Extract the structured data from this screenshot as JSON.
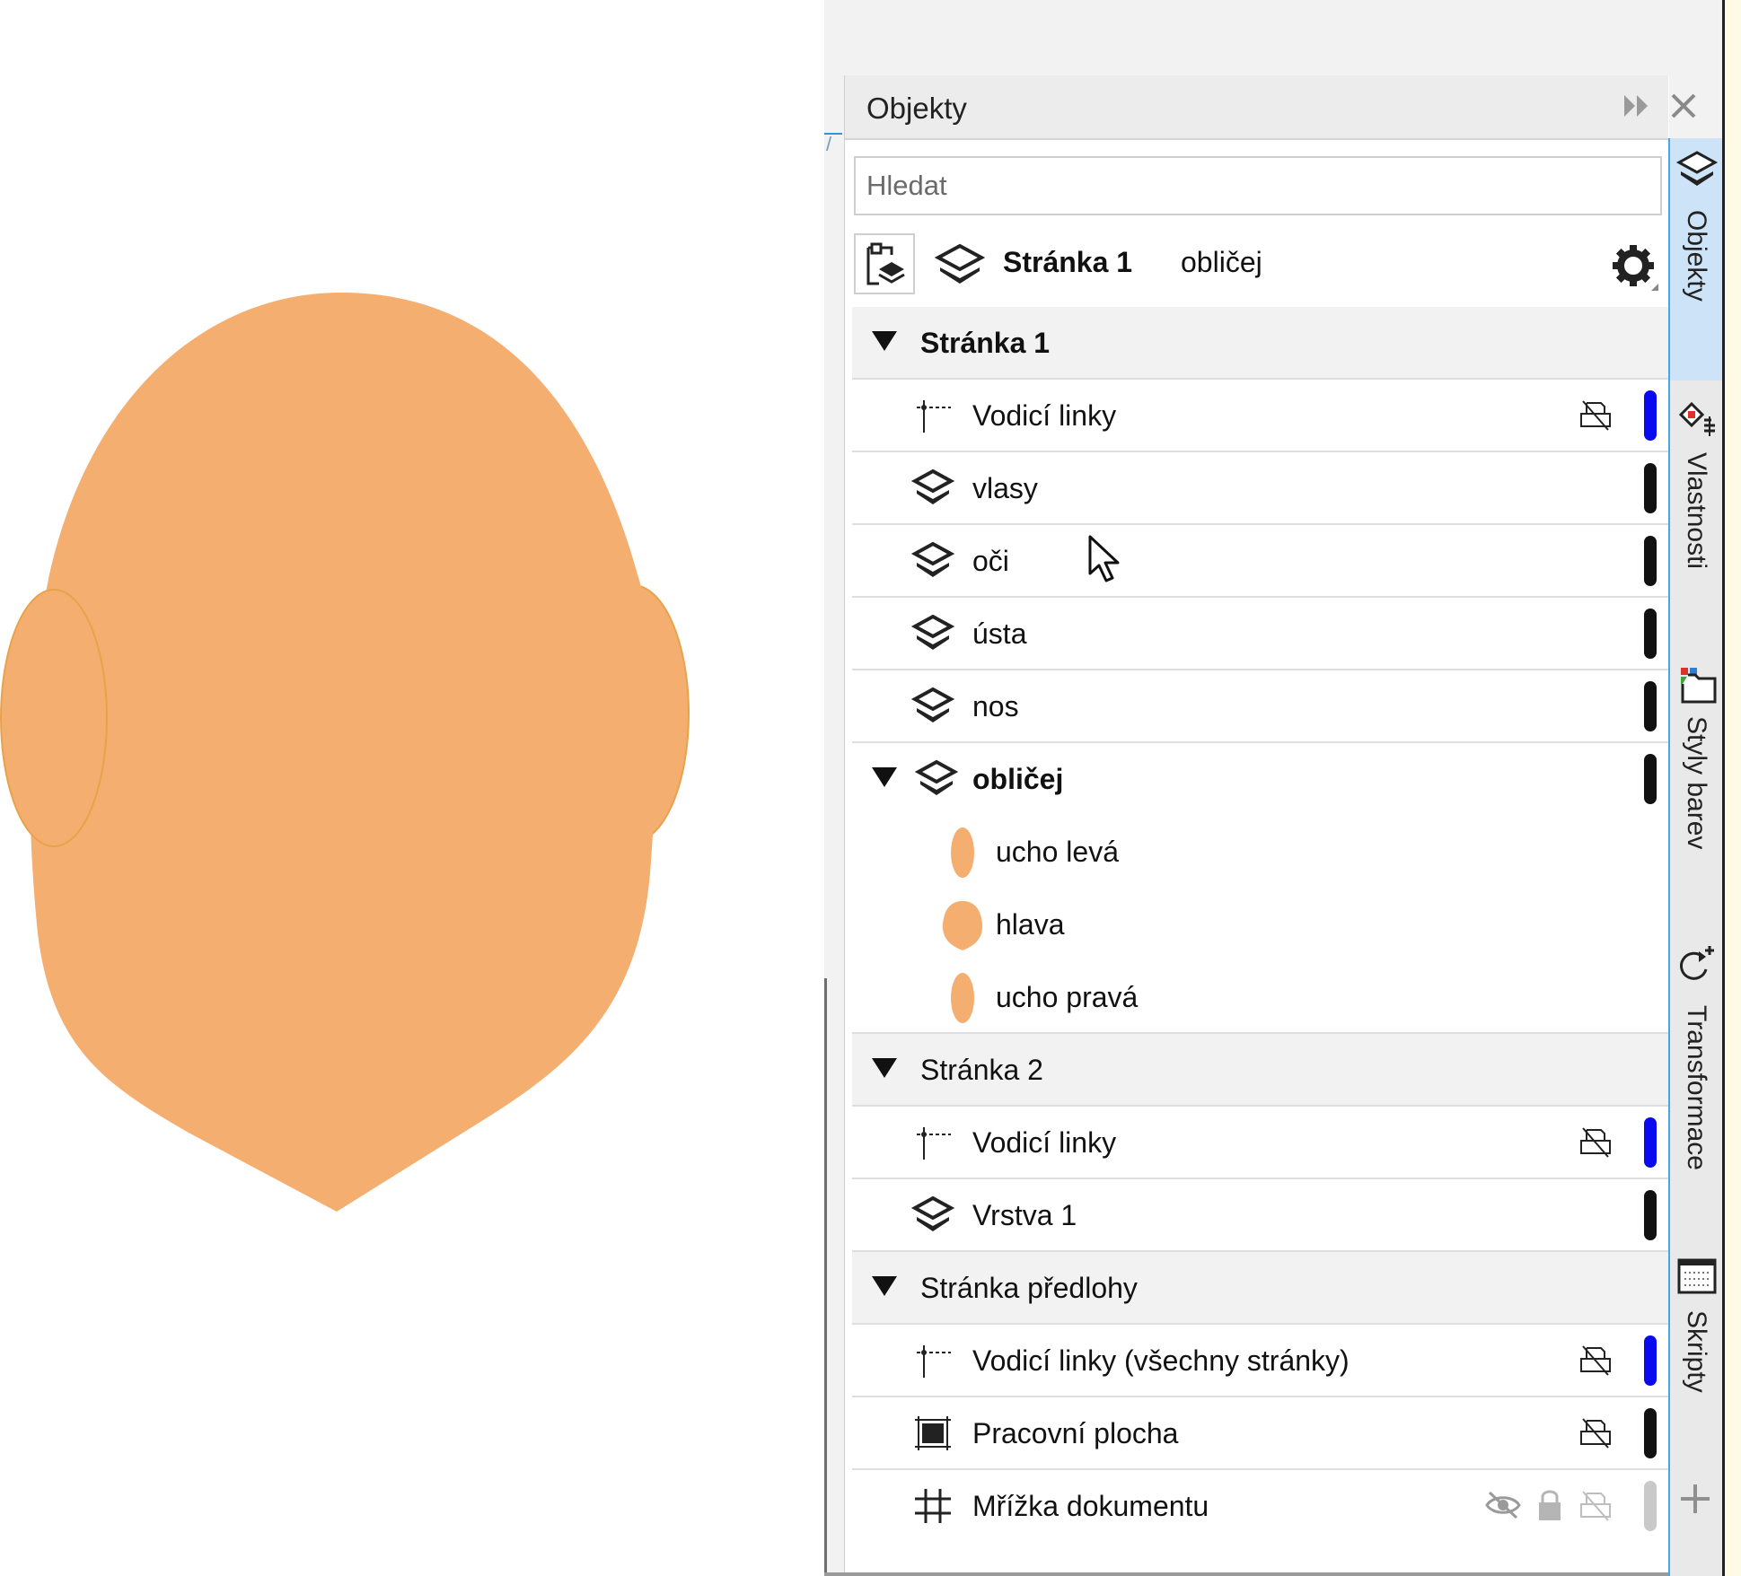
{
  "canvas": {
    "fill_color": "#F4AE70",
    "outline_color": "#E8A24A"
  },
  "panel": {
    "title": "Objekty",
    "search_placeholder": "Hledat",
    "current_page": "Stránka 1",
    "current_layer": "obličej"
  },
  "tree": {
    "page1": {
      "label": "Stránka 1",
      "layers": {
        "guides": "Vodicí linky",
        "hair": "vlasy",
        "eyes": "oči",
        "mouth": "ústa",
        "nose": "nos",
        "face": "obličej"
      },
      "objects": {
        "ear_left": "ucho levá",
        "head": "hlava",
        "ear_right": "ucho pravá"
      }
    },
    "page2": {
      "label": "Stránka 2",
      "layers": {
        "guides": "Vodicí linky",
        "layer1": "Vrstva 1"
      }
    },
    "master": {
      "label": "Stránka předlohy",
      "layers": {
        "guides_all": "Vodicí linky (všechny stránky)",
        "desktop": "Pracovní plocha",
        "grid": "Mřížka dokumentu"
      }
    }
  },
  "colors": {
    "guides_bar": "#0A0AF0",
    "layer_bar": "#111111",
    "grid_bar": "#C9C9C9",
    "tab_accent": "#45A7E6"
  },
  "tabs": {
    "objects": "Objekty",
    "properties": "Vlastnosti",
    "color_styles": "Styly barev",
    "transform": "Transformace",
    "scripts": "Skripty"
  },
  "icons": [
    "collapse-icon",
    "close-icon",
    "new-page-icon",
    "layer-icon",
    "gear-icon",
    "guides-icon",
    "printer-icon",
    "desktop-icon",
    "grid-icon",
    "eye-hidden-icon",
    "lock-icon",
    "properties-icon",
    "color-styles-icon",
    "transform-icon",
    "scripts-icon",
    "plus-icon"
  ]
}
